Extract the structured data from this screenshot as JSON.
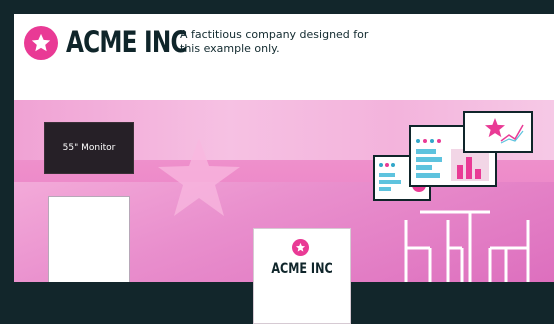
{
  "company": {
    "name": "ACME INC",
    "tagline": "A factitious company designed for this example only."
  },
  "booth": {
    "monitor_label": "55\" Monitor",
    "stand_label": "ACME INC"
  },
  "colors": {
    "brand_pink": "#e93a95",
    "dark": "#12262b",
    "booth_pink": "#ee8fcb"
  },
  "icons": [
    "star-icon"
  ]
}
